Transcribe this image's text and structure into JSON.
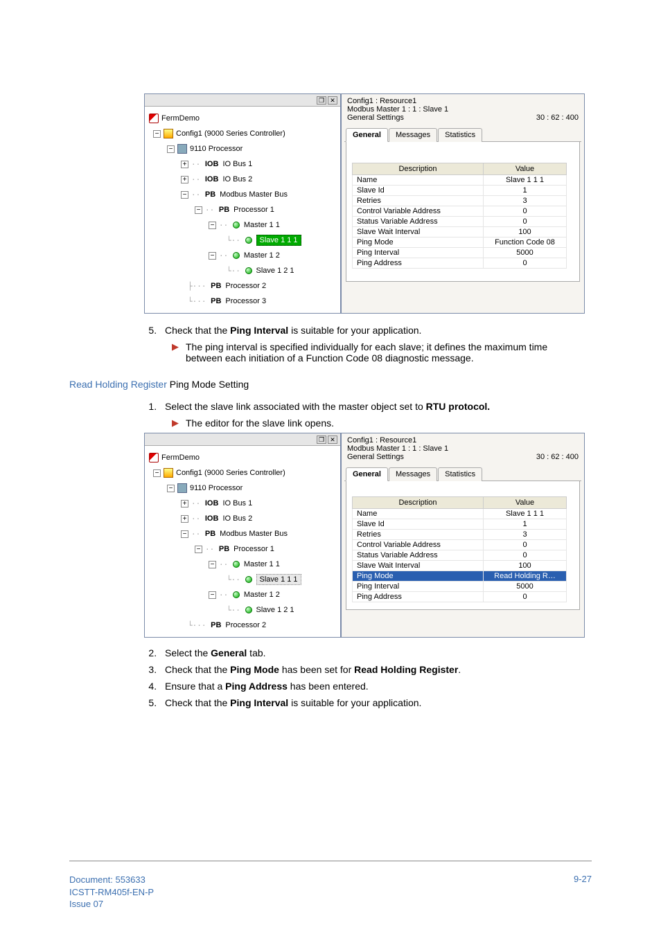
{
  "shot1": {
    "tree": {
      "root": "FermDemo",
      "config": "Config1 (9000 Series Controller)",
      "proc": "9110 Processor",
      "iob1_lbl": "IOB",
      "iob1": "IO Bus 1",
      "iob2_lbl": "IOB",
      "iob2": "IO Bus 2",
      "mbus_lbl": "PB",
      "mbus": "Modbus Master Bus",
      "p1_lbl": "PB",
      "p1": "Processor 1",
      "m11": "Master 1 1",
      "s111": "Slave 1 1 1",
      "m12": "Master 1 2",
      "s121": "Slave 1 2 1",
      "p2_lbl": "PB",
      "p2": "Processor 2",
      "p3_lbl": "PB",
      "p3": "Processor 3"
    },
    "right": {
      "l1": "Config1 : Resource1",
      "l2": "Modbus Master 1 : 1 : Slave 1",
      "l3": "General Settings",
      "stamp": "30 : 62 : 400",
      "tab_general": "General",
      "tab_messages": "Messages",
      "tab_stats": "Statistics",
      "th_desc": "Description",
      "th_val": "Value",
      "rows": [
        {
          "d": "Name",
          "v": "Slave 1 1 1"
        },
        {
          "d": "Slave Id",
          "v": "1"
        },
        {
          "d": "Retries",
          "v": "3"
        },
        {
          "d": "Control Variable Address",
          "v": "0"
        },
        {
          "d": "Status Variable Address",
          "v": "0"
        },
        {
          "d": "Slave Wait Interval",
          "v": "100"
        },
        {
          "d": "Ping Mode",
          "v": "Function Code 08"
        },
        {
          "d": "Ping Interval",
          "v": "5000"
        },
        {
          "d": "Ping Address",
          "v": "0"
        }
      ]
    }
  },
  "text": {
    "step5_a": "Check that the ",
    "step5_ping": "Ping Interval",
    "step5_b": " is suitable for your application.",
    "bullet1": "The ping interval is specified individually for each slave; it defines the maximum time between each initiation of a Function Code 08 diagnostic message.",
    "heading_blue": "Read Holding Register ",
    "heading_black": "Ping Mode Setting",
    "b_step1_a": "Select the slave link associated with the master object set to ",
    "b_step1_b": "RTU protocol.",
    "bullet2": "The editor for the slave link opens.",
    "b_step2_a": "Select the ",
    "b_step2_b": "General",
    "b_step2_c": " tab.",
    "b_step3_a": "Check that the ",
    "b_step3_b": "Ping Mode",
    "b_step3_c": " has been set for ",
    "b_step3_d": "Read Holding Register",
    "b_step3_e": ".",
    "b_step4_a": "Ensure that a ",
    "b_step4_b": "Ping Address",
    "b_step4_c": " has been entered.",
    "b_step5_a": "Check that the ",
    "b_step5_b": "Ping Interval",
    "b_step5_c": " is suitable for your application."
  },
  "shot2": {
    "tree": {
      "root": "FermDemo",
      "config": "Config1 (9000 Series Controller)",
      "proc": "9110 Processor",
      "iob1_lbl": "IOB",
      "iob1": "IO Bus 1",
      "iob2_lbl": "IOB",
      "iob2": "IO Bus 2",
      "mbus_lbl": "PB",
      "mbus": "Modbus Master Bus",
      "p1_lbl": "PB",
      "p1": "Processor 1",
      "m11": "Master 1 1",
      "s111": "Slave 1 1 1",
      "m12": "Master 1 2",
      "s121": "Slave 1 2 1",
      "p2_lbl": "PB",
      "p2": "Processor 2"
    },
    "right": {
      "l1": "Config1 : Resource1",
      "l2": "Modbus Master 1 : 1 : Slave 1",
      "l3": "General Settings",
      "stamp": "30 : 62 : 400",
      "tab_general": "General",
      "tab_messages": "Messages",
      "tab_stats": "Statistics",
      "th_desc": "Description",
      "th_val": "Value",
      "rows": [
        {
          "d": "Name",
          "v": "Slave 1 1 1"
        },
        {
          "d": "Slave Id",
          "v": "1"
        },
        {
          "d": "Retries",
          "v": "3"
        },
        {
          "d": "Control Variable Address",
          "v": "0"
        },
        {
          "d": "Status Variable Address",
          "v": "0"
        },
        {
          "d": "Slave Wait Interval",
          "v": "100"
        },
        {
          "d": "Ping Mode",
          "v": "Read Holding R…"
        },
        {
          "d": "Ping Interval",
          "v": "5000"
        },
        {
          "d": "Ping Address",
          "v": "0"
        }
      ],
      "sel_index": 6
    }
  },
  "footer": {
    "doc": "Document: 553633",
    "code": "ICSTT-RM405f-EN-P",
    "issue": "Issue 07",
    "page": "9-27"
  }
}
